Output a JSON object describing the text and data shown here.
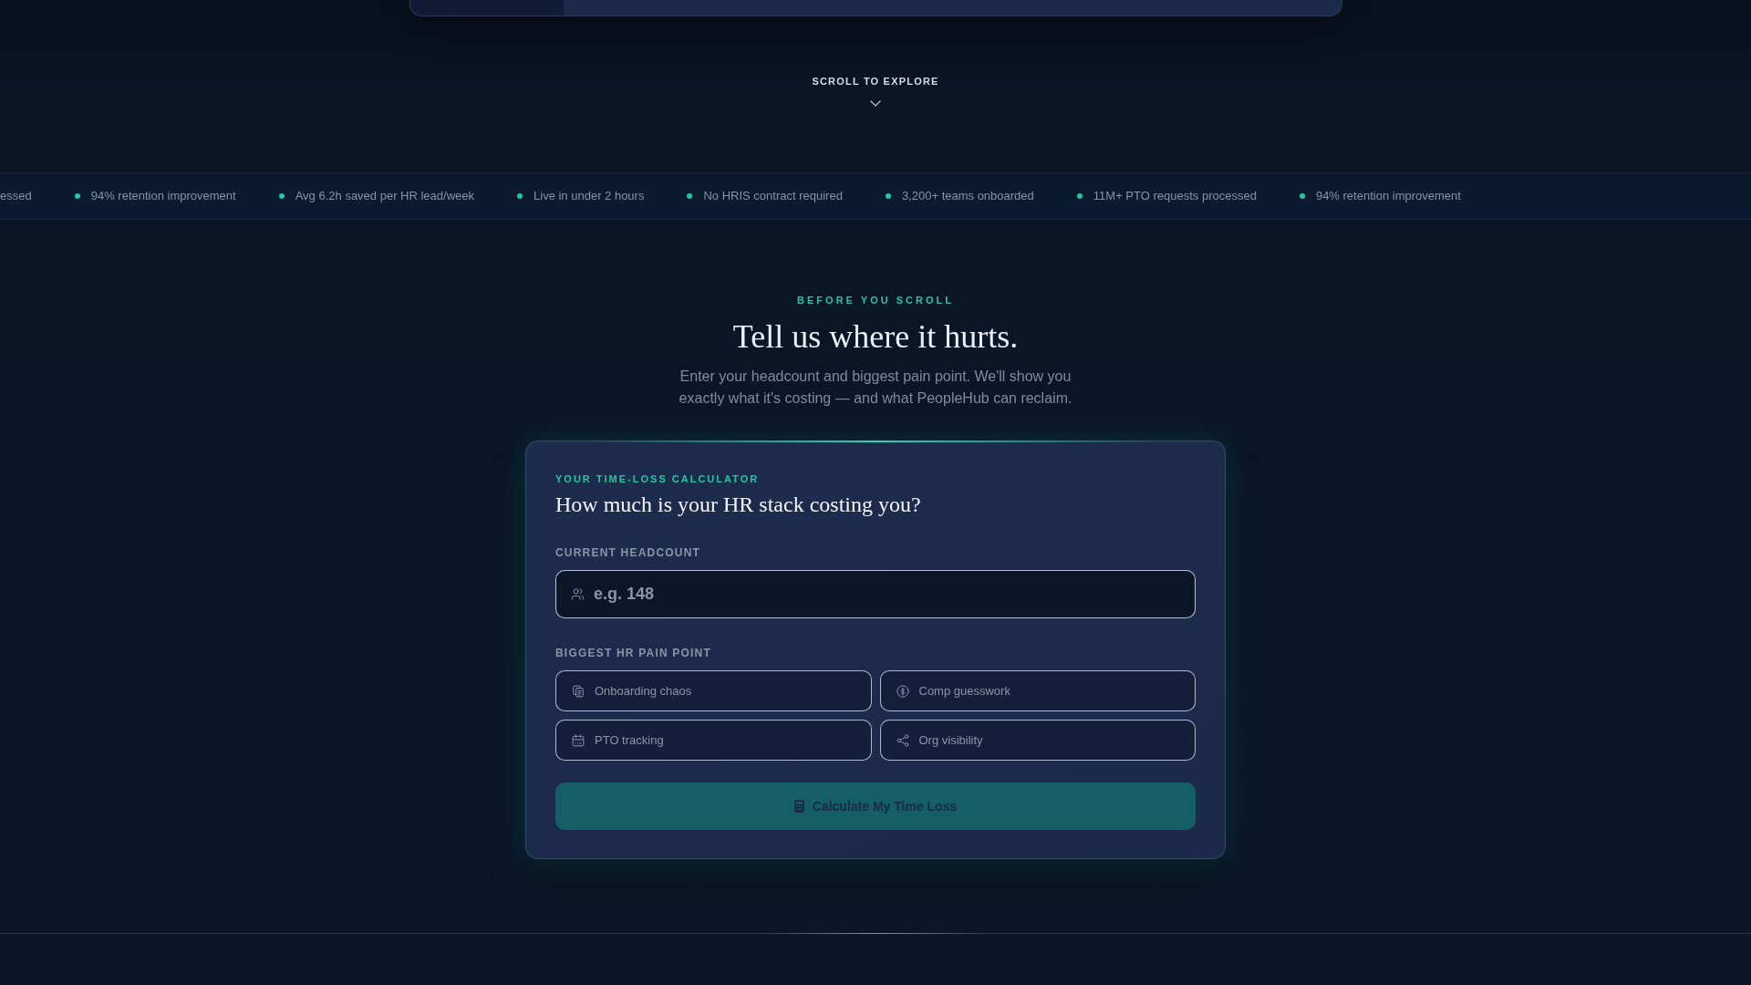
{
  "scroll_hint": {
    "label": "SCROLL TO EXPLORE"
  },
  "ticker": {
    "cut_start": "essed",
    "items": [
      "94% retention improvement",
      "Avg 6.2h saved per HR lead/week",
      "Live in under 2 hours",
      "No HRIS contract required",
      "3,200+ teams onboarded",
      "11M+ PTO requests processed",
      "94% retention improvement"
    ]
  },
  "intro": {
    "eyebrow": "BEFORE YOU SCROLL",
    "title": "Tell us where it hurts.",
    "text": "Enter your headcount and biggest pain point. We'll show you exactly what it's costing — and what PeopleHub can reclaim."
  },
  "calculator": {
    "eyebrow": "YOUR TIME-LOSS CALCULATOR",
    "title": "How much is your HR stack costing you?",
    "headcount": {
      "label": "CURRENT HEADCOUNT",
      "placeholder": "e.g. 148"
    },
    "pain_point": {
      "label": "BIGGEST HR PAIN POINT",
      "options": [
        {
          "label": "Onboarding chaos",
          "selected": false
        },
        {
          "label": "Comp guesswork",
          "selected": false
        },
        {
          "label": "PTO tracking",
          "selected": false
        },
        {
          "label": "Org visibility",
          "selected": false
        }
      ]
    },
    "button": "Calculate My Time Loss"
  }
}
